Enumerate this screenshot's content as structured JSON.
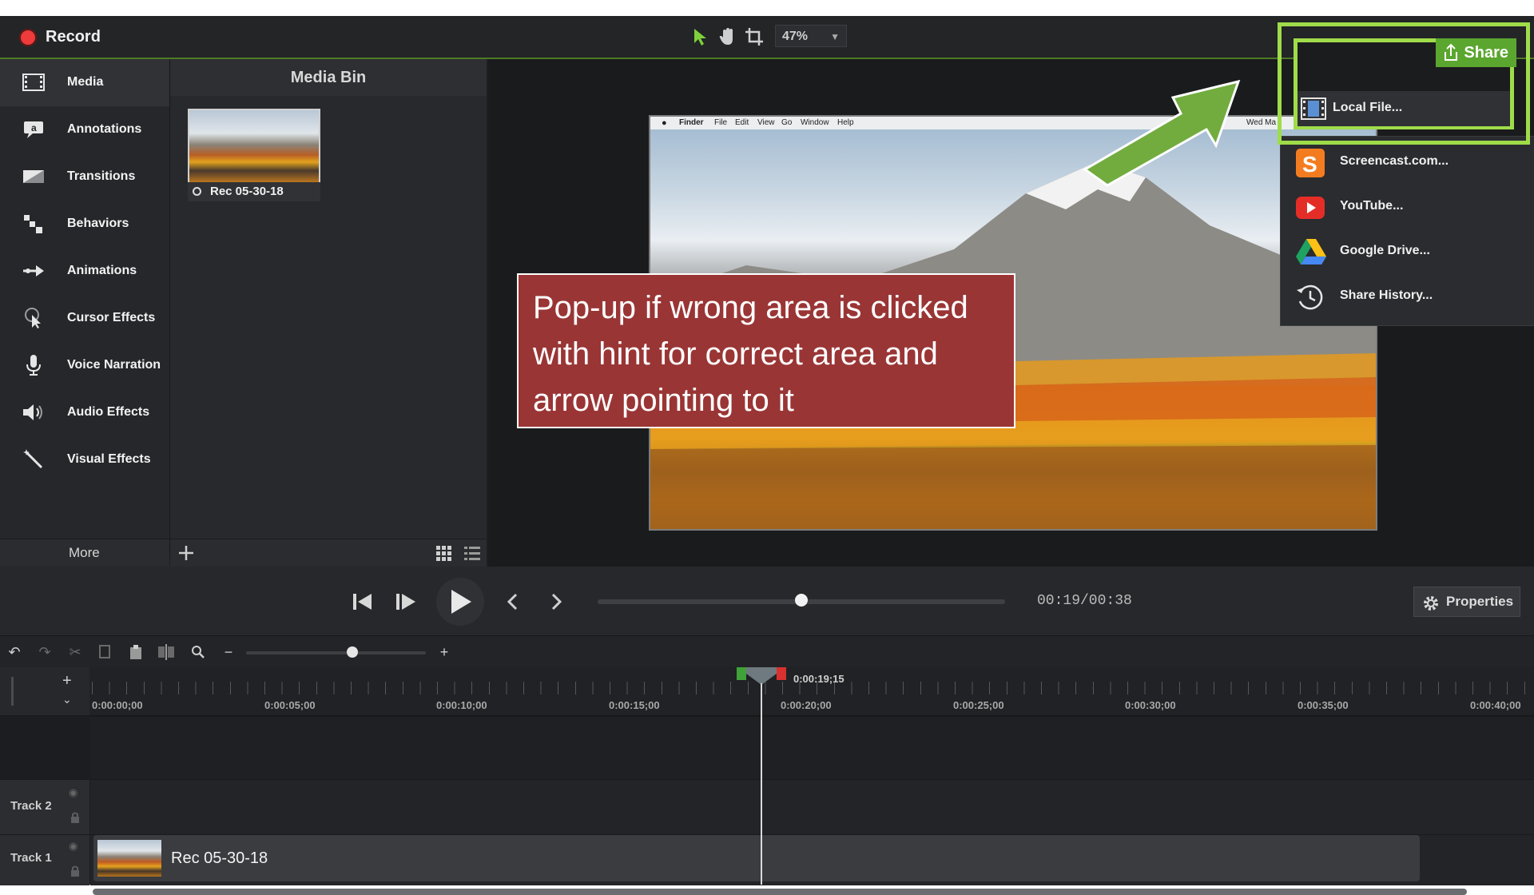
{
  "topbar": {
    "record_label": "Record",
    "zoom_value": "47%"
  },
  "sidebar": {
    "items": [
      {
        "label": "Media",
        "icon": "film-strip-icon"
      },
      {
        "label": "Annotations",
        "icon": "annotation-icon"
      },
      {
        "label": "Transitions",
        "icon": "transition-icon"
      },
      {
        "label": "Behaviors",
        "icon": "behaviors-icon"
      },
      {
        "label": "Animations",
        "icon": "animation-arrow-icon"
      },
      {
        "label": "Cursor Effects",
        "icon": "cursor-effects-icon"
      },
      {
        "label": "Voice Narration",
        "icon": "microphone-icon"
      },
      {
        "label": "Audio Effects",
        "icon": "speaker-icon"
      },
      {
        "label": "Visual Effects",
        "icon": "magic-wand-icon"
      }
    ],
    "more_label": "More"
  },
  "media_bin": {
    "title": "Media Bin",
    "items": [
      {
        "label": "Rec 05-30-18"
      }
    ]
  },
  "preview": {
    "menubar": [
      "Finder",
      "File",
      "Edit",
      "View",
      "Go",
      "Window",
      "Help"
    ],
    "menubar_right": "Wed Ma"
  },
  "callout": {
    "text": "Pop-up if wrong area is clicked with hint for correct area and arrow pointing to it"
  },
  "share": {
    "button_label": "Share",
    "menu": [
      {
        "label": "Local File...",
        "icon": "film-icon"
      },
      {
        "label": "Screencast.com...",
        "icon": "screencast-icon"
      },
      {
        "label": "YouTube...",
        "icon": "youtube-icon"
      },
      {
        "label": "Google Drive...",
        "icon": "google-drive-icon"
      },
      {
        "label": "Share History...",
        "icon": "history-icon"
      }
    ]
  },
  "playback": {
    "timecode": "00:19/00:38",
    "progress": 0.5,
    "properties_label": "Properties"
  },
  "timeline": {
    "playhead_time": "0:00:19;15",
    "ruler_labels": [
      "0:00:00;00",
      "0:00:05;00",
      "0:00:10;00",
      "0:00:15;00",
      "0:00:20;00",
      "0:00:25;00",
      "0:00:30;00",
      "0:00:35;00",
      "0:00:40;00"
    ],
    "tracks": [
      {
        "label": "Track 2"
      },
      {
        "label": "Track 1",
        "clip": "Rec 05-30-18"
      }
    ]
  },
  "colors": {
    "accent_green": "#9fdc4a",
    "share_button": "#5ba62f",
    "callout_bg": "#9a3535",
    "record_red": "#ee3b3b"
  }
}
